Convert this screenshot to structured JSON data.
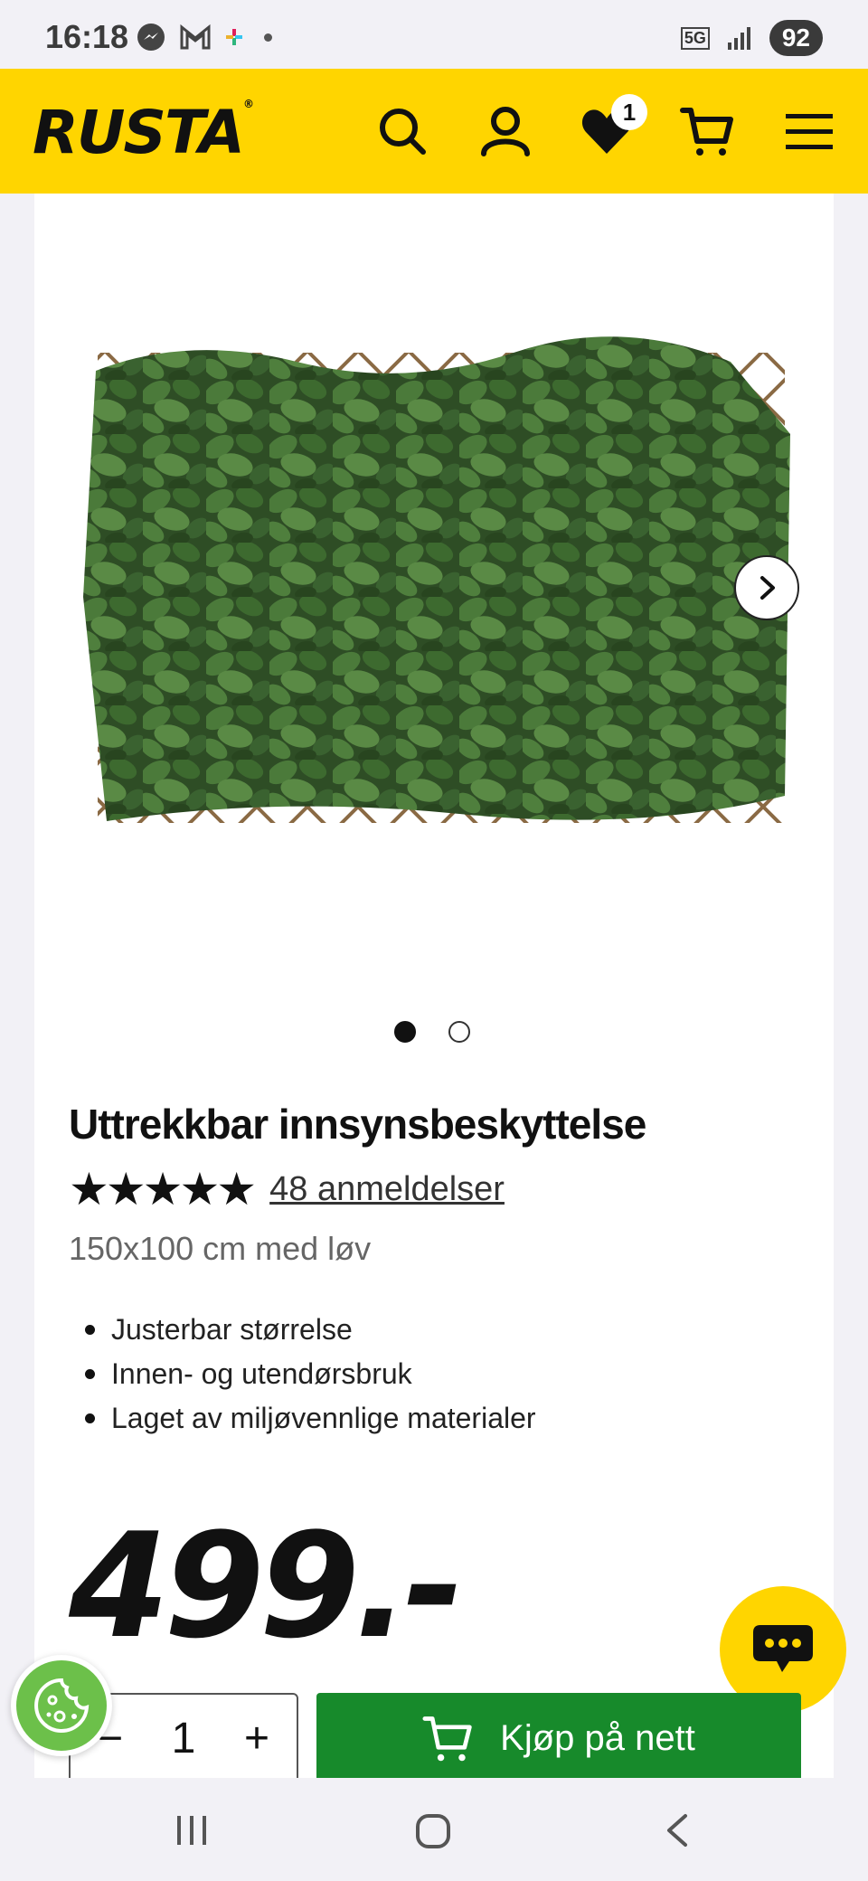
{
  "status_bar": {
    "time": "16:18",
    "network": "5G",
    "battery": "92"
  },
  "header": {
    "logo": "RUSTA",
    "wishlist_count": "1"
  },
  "product": {
    "title": "Uttrekkbar innsynsbeskyttelse",
    "stars": "★★★★★",
    "rating": 5,
    "reviews_link": "48 anmeldelser",
    "variant": "150x100 cm med løv",
    "features": [
      "Justerbar størrelse",
      "Innen- og utendørsbruk",
      "Laget av miljøvennlige materialer"
    ],
    "price": "499.-",
    "image_slide_count": 2,
    "active_slide": 1
  },
  "purchase": {
    "quantity": "1",
    "minus": "−",
    "plus": "+",
    "buy_label": "Kjøp på nett"
  },
  "colors": {
    "brand_yellow": "#ffd500",
    "buy_green": "#178a2b",
    "cookie_green": "#6cc04a"
  },
  "icons": [
    "search-icon",
    "account-icon",
    "heart-icon",
    "cart-icon",
    "menu-icon",
    "chevron-right-icon",
    "chat-icon",
    "cookie-icon"
  ]
}
